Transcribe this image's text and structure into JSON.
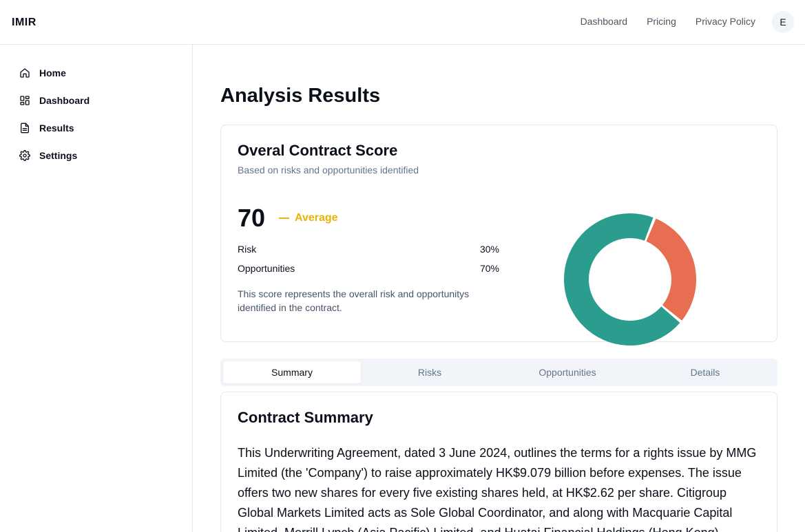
{
  "header": {
    "brand": "IMIR",
    "nav": [
      "Dashboard",
      "Pricing",
      "Privacy Policy"
    ],
    "avatar_initial": "E"
  },
  "sidebar": {
    "items": [
      {
        "label": "Home",
        "icon": "home-icon"
      },
      {
        "label": "Dashboard",
        "icon": "dashboard-icon"
      },
      {
        "label": "Results",
        "icon": "document-icon"
      },
      {
        "label": "Settings",
        "icon": "gear-icon"
      }
    ]
  },
  "main": {
    "title": "Analysis Results",
    "score_card": {
      "title": "Overal Contract Score",
      "subtitle": "Based on risks and opportunities identified",
      "score": "70",
      "level": "Average",
      "level_color": "#eab308",
      "metrics": [
        {
          "label": "Risk",
          "value": "30%"
        },
        {
          "label": "Opportunities",
          "value": "70%"
        }
      ],
      "note": "This score represents the overall risk and opportunitys identified in the contract."
    },
    "chart_data": {
      "type": "pie",
      "categories": [
        "Risk",
        "Opportunities"
      ],
      "values": [
        30,
        70
      ],
      "colors": [
        "#e76e50",
        "#2a9d8f"
      ],
      "donut": true
    },
    "tabs": [
      "Summary",
      "Risks",
      "Opportunities",
      "Details"
    ],
    "active_tab": "Summary",
    "summary": {
      "title": "Contract Summary",
      "text": "This Underwriting Agreement, dated 3 June 2024, outlines the terms for a rights issue by MMG Limited (the 'Company') to raise approximately HK$9.079 billion before expenses. The issue offers two new shares for every five existing shares held, at HK$2.62 per share. Citigroup Global Markets Limited acts as Sole Global Coordinator, and along with Macquarie Capital Limited, Merrill Lynch (Asia Pacific) Limited, and Huatai Financial Holdings (Hong Kong)"
    }
  }
}
